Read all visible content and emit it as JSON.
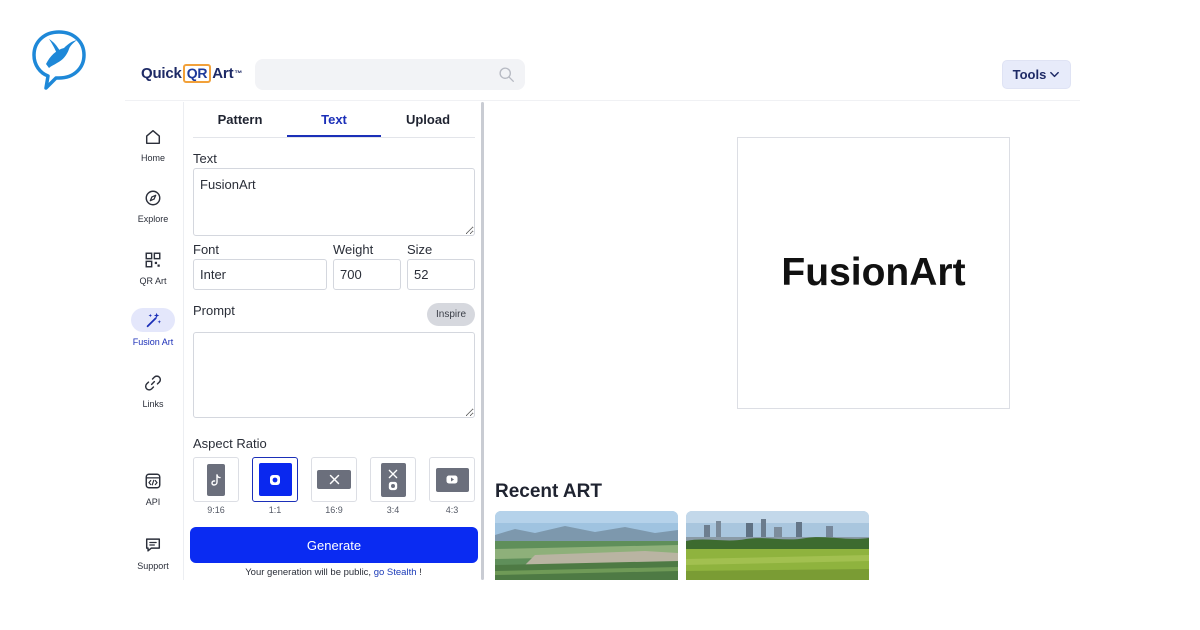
{
  "brand": {
    "name_prefix": "Quick",
    "name_qr": "QR",
    "name_suffix": "Art",
    "trademark": "™"
  },
  "search": {
    "value": "",
    "placeholder": ""
  },
  "header": {
    "tools_label": "Tools"
  },
  "nav": {
    "items": [
      {
        "label": "Home",
        "icon": "home-icon"
      },
      {
        "label": "Explore",
        "icon": "compass-icon"
      },
      {
        "label": "QR Art",
        "icon": "qr-code-icon"
      },
      {
        "label": "Fusion Art",
        "icon": "magic-wand-icon",
        "active": true
      },
      {
        "label": "Links",
        "icon": "link-icon"
      },
      {
        "label": "API",
        "icon": "code-icon"
      },
      {
        "label": "Support",
        "icon": "chat-icon"
      }
    ]
  },
  "panel": {
    "tabs": [
      {
        "label": "Pattern"
      },
      {
        "label": "Text",
        "active": true
      },
      {
        "label": "Upload"
      }
    ],
    "text_label": "Text",
    "text_value": "FusionArt",
    "font_label": "Font",
    "font_value": "Inter",
    "weight_label": "Weight",
    "weight_value": "700",
    "size_label": "Size",
    "size_value": "52",
    "prompt_label": "Prompt",
    "prompt_value": "",
    "inspire_label": "Inspire",
    "aspect_label": "Aspect Ratio",
    "ratios": [
      {
        "label": "9:16",
        "icon": "tiktok-icon"
      },
      {
        "label": "1:1",
        "icon": "instagram-icon",
        "selected": true
      },
      {
        "label": "16:9",
        "icon": "x-twitter-icon"
      },
      {
        "label": "3:4",
        "icon": "x-instagram-icon"
      },
      {
        "label": "4:3",
        "icon": "youtube-icon"
      }
    ],
    "generate_label": "Generate",
    "notice_text": "Your generation will be public, ",
    "notice_link": "go Stealth",
    "notice_suffix": " !"
  },
  "preview": {
    "text": "FusionArt"
  },
  "recent": {
    "title": "Recent ART"
  },
  "colors": {
    "accent": "#0a2bf2",
    "nav_active_bg": "#e4e7fb",
    "brand_navy": "#1e2a66"
  }
}
